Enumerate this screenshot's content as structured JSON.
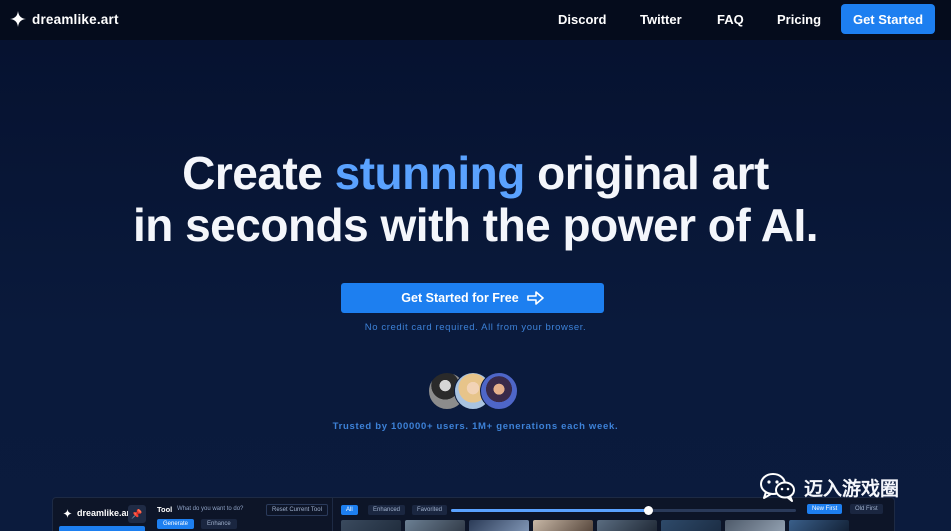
{
  "nav": {
    "logo": "dreamlike.art",
    "links": [
      "Discord",
      "Twitter",
      "FAQ",
      "Pricing"
    ],
    "cta": "Get Started"
  },
  "hero": {
    "headline_pre": "Create ",
    "headline_accent": "stunning",
    "headline_post": " original art",
    "headline_line2": "in seconds with the power of AI.",
    "cta": "Get Started for Free",
    "subtext": "No credit card required. All from your browser.",
    "trusted": "Trusted by 100000+ users. 1M+ generations each week."
  },
  "preview": {
    "logo": "dreamlike.art",
    "tool_label": "Tool",
    "tool_question": "What do you want to do?",
    "reset": "Reset Current Tool",
    "generate": "Generate",
    "enhance": "Enhance",
    "filters": [
      "All",
      "Enhanced",
      "Favorited"
    ],
    "sort": [
      "New First",
      "Old First"
    ],
    "slider_value": 0.57
  },
  "watermark": "迈入游戏圈",
  "colors": {
    "accent": "#5aa2ff",
    "button": "#1d7ff0",
    "background": "#08142e",
    "navbar": "#050c1c",
    "subtext": "#3d82d8"
  }
}
